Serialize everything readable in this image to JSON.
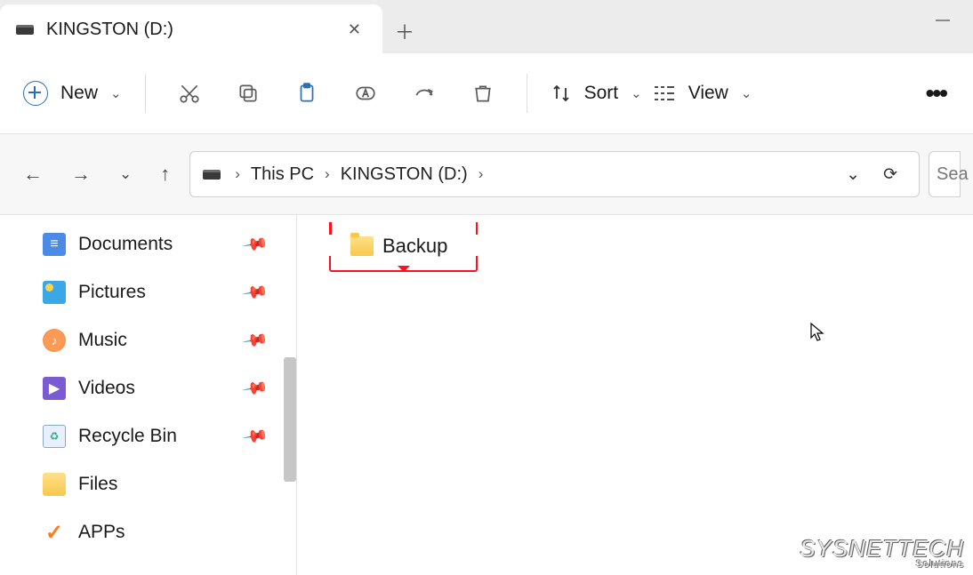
{
  "window": {
    "title": "KINGSTON (D:)"
  },
  "toolbar": {
    "new_label": "New",
    "sort_label": "Sort",
    "view_label": "View"
  },
  "breadcrumbs": [
    {
      "label": "This PC"
    },
    {
      "label": "KINGSTON (D:)"
    }
  ],
  "search": {
    "placeholder": "Sea"
  },
  "sidebar": {
    "items": [
      {
        "label": "Documents",
        "pinned": true,
        "icon": "document"
      },
      {
        "label": "Pictures",
        "pinned": true,
        "icon": "pictures"
      },
      {
        "label": "Music",
        "pinned": true,
        "icon": "music"
      },
      {
        "label": "Videos",
        "pinned": true,
        "icon": "videos"
      },
      {
        "label": "Recycle Bin",
        "pinned": true,
        "icon": "recycle"
      },
      {
        "label": "Files",
        "pinned": false,
        "icon": "folder"
      },
      {
        "label": "APPs",
        "pinned": false,
        "icon": "check"
      }
    ]
  },
  "content": {
    "folders": [
      {
        "name": "Backup"
      }
    ]
  },
  "watermark": {
    "brand": "SYSNETTECH",
    "sub": "Solutions"
  }
}
